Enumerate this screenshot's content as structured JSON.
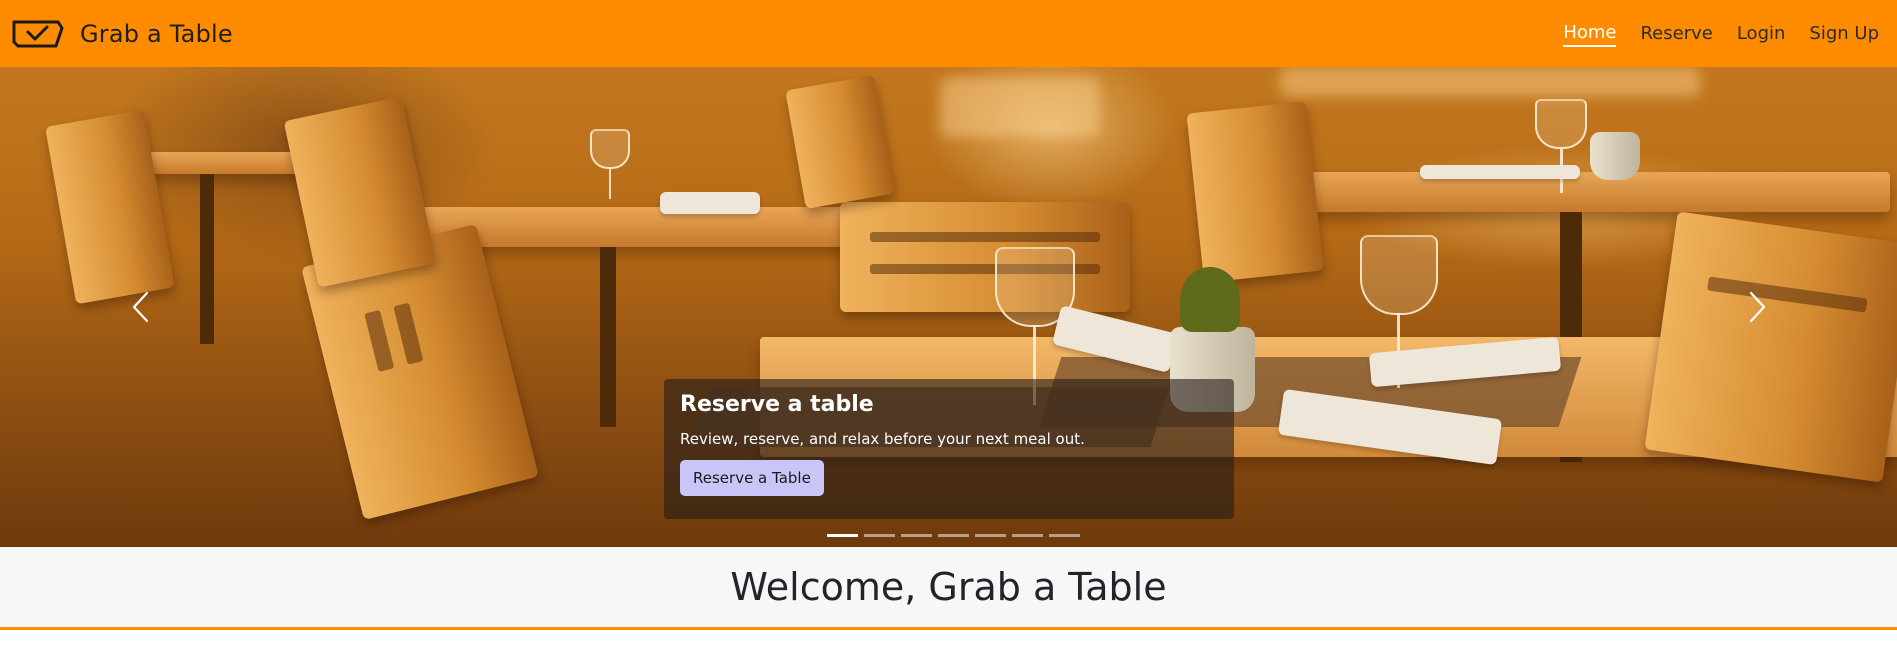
{
  "brand": {
    "name": "Grab a Table",
    "logo_icon": "ticket-check-icon"
  },
  "nav": {
    "items": [
      {
        "label": "Home",
        "active": true
      },
      {
        "label": "Reserve",
        "active": false
      },
      {
        "label": "Login",
        "active": false
      },
      {
        "label": "Sign Up",
        "active": false
      }
    ]
  },
  "carousel": {
    "prev_icon": "chevron-left-icon",
    "next_icon": "chevron-right-icon",
    "caption": {
      "title": "Reserve a table",
      "text": "Review, reserve, and relax before your next meal out.",
      "button_label": "Reserve a Table"
    },
    "slide_count": 7,
    "active_slide": 1
  },
  "welcome": {
    "title": "Welcome, Grab a Table"
  },
  "colors": {
    "primary": "#ff8c00",
    "button": "#c8c6f7",
    "welcome_bg": "#f7f7f8",
    "text_dark": "#22242a"
  }
}
